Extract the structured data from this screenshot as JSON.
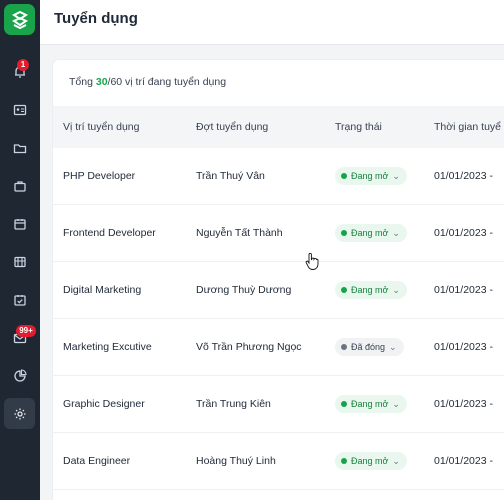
{
  "sidebar": {
    "items": [
      {
        "icon": "bell-icon",
        "badge": "1"
      },
      {
        "icon": "id-card-icon"
      },
      {
        "icon": "folder-icon"
      },
      {
        "icon": "briefcase-icon"
      },
      {
        "icon": "calendar-icon"
      },
      {
        "icon": "table-icon"
      },
      {
        "icon": "calendar-check-icon"
      },
      {
        "icon": "mail-icon",
        "badge": "99+"
      },
      {
        "icon": "pie-chart-icon"
      },
      {
        "icon": "gear-icon"
      }
    ]
  },
  "header": {
    "title": "Tuyển dụng"
  },
  "summary": {
    "prefix": "Tổng ",
    "open_count": "30",
    "rest": "/60 vị trí đang tuyển dụng"
  },
  "table": {
    "columns": [
      "Vị trí tuyển dụng",
      "Đợt tuyển dụng",
      "Trạng thái",
      "Thời gian tuyể"
    ],
    "rows": [
      {
        "position": "PHP Developer",
        "owner": "Trần Thuý Vân",
        "status": "Đang mở",
        "status_type": "open",
        "date": "01/01/2023 -"
      },
      {
        "position": "Frontend Developer",
        "owner": "Nguyễn Tất Thành",
        "status": "Đang mở",
        "status_type": "open",
        "date": "01/01/2023 -"
      },
      {
        "position": "Digital Marketing",
        "owner": "Dương Thuỳ Dương",
        "status": "Đang mở",
        "status_type": "open",
        "date": "01/01/2023 -"
      },
      {
        "position": "Marketing Excutive",
        "owner": "Võ Trần Phương Ngọc",
        "status": "Đã đóng",
        "status_type": "closed",
        "date": "01/01/2023 -"
      },
      {
        "position": "Graphic Designer",
        "owner": "Trần Trung Kiên",
        "status": "Đang mở",
        "status_type": "open",
        "date": "01/01/2023 -"
      },
      {
        "position": "Data Engineer",
        "owner": "Hoàng Thuý Linh",
        "status": "Đang mở",
        "status_type": "open",
        "date": "01/01/2023 -"
      }
    ]
  },
  "colors": {
    "accent": "#19a34a",
    "sidebar": "#1f2733",
    "badge": "#e11d2e"
  }
}
